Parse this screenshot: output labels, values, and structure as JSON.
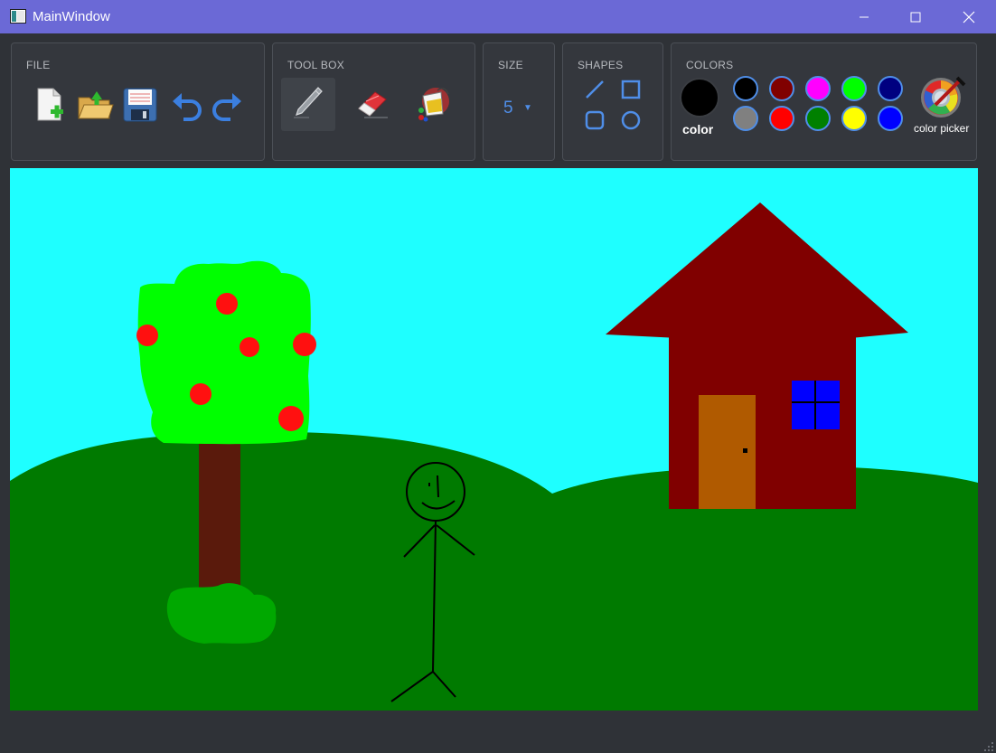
{
  "window": {
    "title": "MainWindow",
    "icons": {
      "app": "app-window-icon",
      "minimize": "minimize-icon",
      "maximize": "maximize-icon",
      "close": "close-icon"
    }
  },
  "toolbar": {
    "file": {
      "title": "FILE",
      "icons": [
        "new-file-icon",
        "open-folder-icon",
        "save-icon",
        "undo-icon",
        "redo-icon"
      ]
    },
    "toolbox": {
      "title": "TOOL BOX",
      "icons": [
        "pencil-icon",
        "eraser-icon",
        "fill-bucket-icon"
      ],
      "active": "pencil-icon"
    },
    "size": {
      "title": "SIZE",
      "value": "5"
    },
    "shapes": {
      "title": "SHAPES",
      "icons": [
        "line-icon",
        "rectangle-icon",
        "rounded-rectangle-icon",
        "circle-icon"
      ]
    },
    "colors": {
      "title": "COLORS",
      "current_label": "color",
      "current_color": "#000000",
      "palette": [
        "#000000",
        "#800000",
        "#ff00ff",
        "#00ff00",
        "#000080",
        "#808080",
        "#ff0000",
        "#008000",
        "#ffff00",
        "#0000ff"
      ],
      "picker_label": "color picker",
      "picker_icon": "color-picker-icon"
    }
  },
  "theme": {
    "titlebar": "#6b69d6",
    "panel": "#2f3237",
    "accent": "#4f8ee8"
  },
  "canvas": {
    "sky": "#1effff",
    "hills": "#007a00",
    "tree_leaves": "#00ff00",
    "tree_trunk": "#5a1a0c",
    "apples": "#ff1010",
    "bush": "#00a800",
    "house_walls": "#800000",
    "house_door": "#b05a00",
    "house_window": "#0000ff",
    "stick_figure": "#000000"
  }
}
